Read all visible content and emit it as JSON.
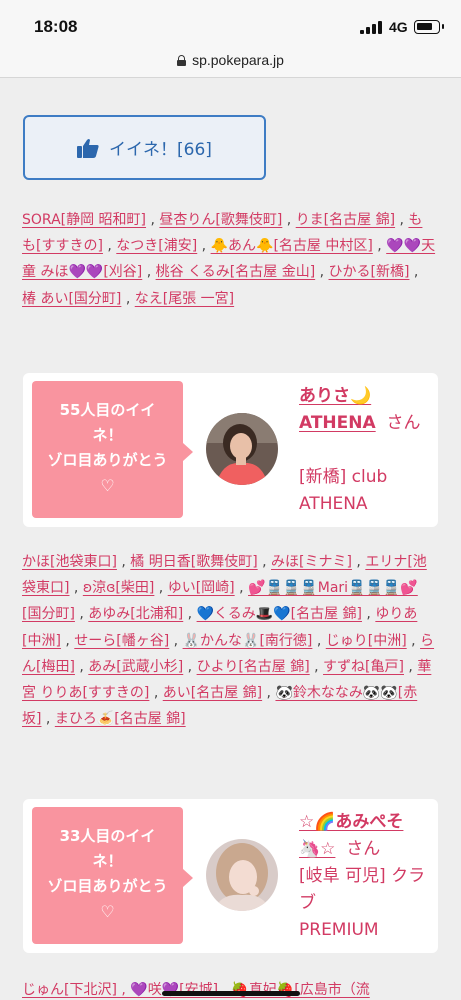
{
  "status": {
    "time": "18:08",
    "network": "4G"
  },
  "browser": {
    "url": "sp.pokepara.jp"
  },
  "like_button": {
    "label": "イイネ！[66]"
  },
  "likers_1": [
    "SORA[静岡 昭和町]",
    "昼杏りん[歌舞伎町]",
    "りま[名古屋 錦]",
    "もも[すすきの]",
    "なつき[浦安]",
    "🐥あん🐥[名古屋 中村区]",
    "💜💜天童 みほ💜💜[刈谷]",
    "桃谷 くるみ[名古屋 金山]",
    "ひかる[新橋]",
    "椿 あい[国分町]",
    "なえ[尾張 一宮]"
  ],
  "card_1": {
    "message_line1": "55人目のイイ",
    "message_line2": "ネ！",
    "message_line3": "ゾロ目ありがとう",
    "heart": "♡",
    "girl_name_line1": "ありさ🌙",
    "girl_name_line2": "ATHENA",
    "san": "さん",
    "shop_line1": "[新橋] club",
    "shop_line2": "ATHENA"
  },
  "likers_2": [
    "かほ[池袋東口]",
    "橘 明日香[歌舞伎町]",
    "みほ[ミナミ]",
    "エリナ[池袋東口]",
    "ʚ涼ɞ[柴田]",
    "ゆい[岡崎]",
    "💕🚆🚆🚆Mari🚆🚆🚆💕[国分町]",
    "あゆみ[北浦和]",
    "💙くるみ🎩💙[名古屋 錦]",
    "ゆりあ[中洲]",
    "せーら[幡ヶ谷]",
    "🐰かんな🐰[南行徳]",
    "じゅり[中洲]",
    "らん[梅田]",
    "あみ[武蔵小杉]",
    "ひより[名古屋 錦]",
    "すずね[亀戸]",
    "華宮 りりあ[すすきの]",
    "あい[名古屋 錦]",
    "🐼鈴木ななみ🐼🐼[赤坂]",
    "まひろ🍝[名古屋 錦]"
  ],
  "card_2": {
    "message_line1": "33人目のイイ",
    "message_line2": "ネ！",
    "message_line3": "ゾロ目ありがとう",
    "heart": "♡",
    "girl_name_line1": "☆🌈あみぺそ",
    "girl_name_line2": "🦄☆",
    "san": "さん",
    "shop_line1": "[岐阜 可児] クラ",
    "shop_line2": "ブ",
    "shop_line3": "PREMIUM"
  },
  "likers_3_partial": "じゅん[下北沢] , 💜咲💜[安城] , 🍓真妃🍓[広島市（流"
}
